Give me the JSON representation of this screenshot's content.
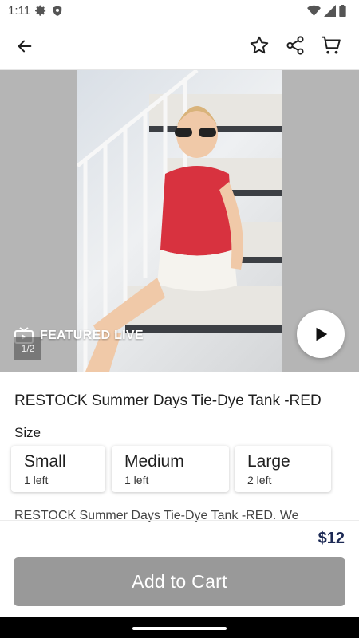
{
  "status_bar": {
    "time": "1:11",
    "left_icons": [
      "gear-icon",
      "shield-icon"
    ],
    "right_icons": [
      "wifi-icon",
      "signal-icon",
      "battery-icon"
    ]
  },
  "app_bar": {
    "icons": [
      "back-arrow-icon",
      "star-outline-icon",
      "share-icon",
      "shopping-cart-icon"
    ]
  },
  "media": {
    "live_label": "FEATURED LIVE",
    "pager": "1/2",
    "overlay_color": "#b5b5b5"
  },
  "product": {
    "title": "RESTOCK Summer Days Tie-Dye Tank -RED",
    "size_label": "Size",
    "sizes": [
      {
        "name": "Small",
        "stock": "1 left"
      },
      {
        "name": "Medium",
        "stock": "1 left"
      },
      {
        "name": "Large",
        "stock": "2 left"
      }
    ],
    "description": "RESTOCK Summer Days Tie-Dye Tank -RED. We",
    "price": "$12",
    "price_color": "#1d2a55"
  },
  "actions": {
    "add_to_cart": "Add to Cart",
    "button_color": "#999999"
  }
}
